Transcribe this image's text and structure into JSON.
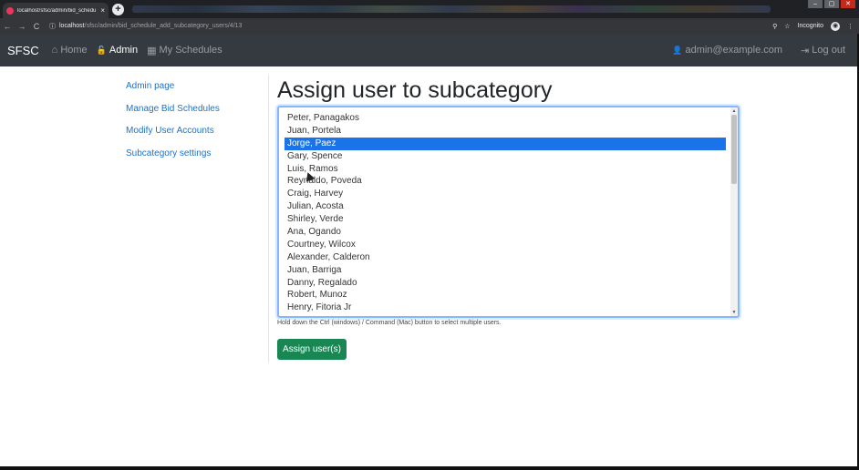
{
  "browser": {
    "tab_title": "localhost/sfsc/admin/bid_schedu",
    "tab_close": "×",
    "new_tab": "+",
    "url_host": "localhost",
    "url_path": "/sfsc/admin/bid_schedule_add_subcategory_users/4/13",
    "back": "←",
    "forward": "→",
    "reload": "C",
    "info": "ⓘ",
    "zoom_icon": "⚲",
    "star_icon": "☆",
    "incognito_label": "Incognito",
    "menu": "⋮",
    "window_controls": [
      "–",
      "▢",
      "✕"
    ]
  },
  "navbar": {
    "brand": "SFSC",
    "home_icon": "⌂",
    "home": "Home",
    "admin_icon": "🔓",
    "admin": "Admin",
    "schedules_icon": "▦",
    "schedules": "My Schedules",
    "user_icon": "👤",
    "user": "admin@example.com",
    "logout_icon": "⇥",
    "logout": "Log out"
  },
  "sidebar": {
    "items": [
      {
        "label": "Admin page"
      },
      {
        "label": "Manage Bid Schedules"
      },
      {
        "label": "Modify User Accounts"
      },
      {
        "label": "Subcategory settings"
      }
    ]
  },
  "main": {
    "title": "Assign user to subcategory",
    "users": [
      "Peter, Panagakos",
      "Juan, Portela",
      "Jorge, Paez",
      "Gary, Spence",
      "Luis, Ramos",
      "Reynaldo, Poveda",
      "Craig, Harvey",
      "Julian, Acosta",
      "Shirley, Verde",
      "Ana, Ogando",
      "Courtney, Wilcox",
      "Alexander, Calderon",
      "Juan, Barriga",
      "Danny, Regalado",
      "Robert, Munoz",
      "Henry, Fitoria Jr"
    ],
    "selected_user": "Jorge, Paez",
    "help_text": "Hold down the Ctrl (windows) / Command (Mac) button to select multiple users.",
    "assign_button": "Assign user(s)",
    "scroll_up": "▲",
    "scroll_down": "▼"
  },
  "colors": {
    "navbar_bg": "#343a40",
    "link": "#1a73c8",
    "selected_bg": "#1a73e8",
    "button_bg": "#198754"
  }
}
